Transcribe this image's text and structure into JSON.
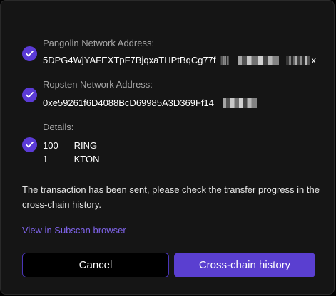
{
  "pangolin": {
    "label": "Pangolin Network Address:",
    "address_visible": "5DPG4WjYAFEXTpF7BjqxaTHPtBqCg77f",
    "address_tail": "x"
  },
  "ropsten": {
    "label": "Ropsten Network Address:",
    "address_visible": "0xe59261f6D4088BcD69985A3D369Ff14"
  },
  "details": {
    "label": "Details:",
    "items": [
      {
        "amount": "100",
        "token": "RING"
      },
      {
        "amount": "1",
        "token": "KTON"
      }
    ]
  },
  "message": "The transaction has been sent, please check the transfer progress in the cross-chain history.",
  "link_text": "View in Subscan browser",
  "buttons": {
    "cancel": "Cancel",
    "history": "Cross-chain history"
  },
  "colors": {
    "accent": "#5a3fd0",
    "link": "#7e63e8",
    "check": "#5b3bd6"
  }
}
